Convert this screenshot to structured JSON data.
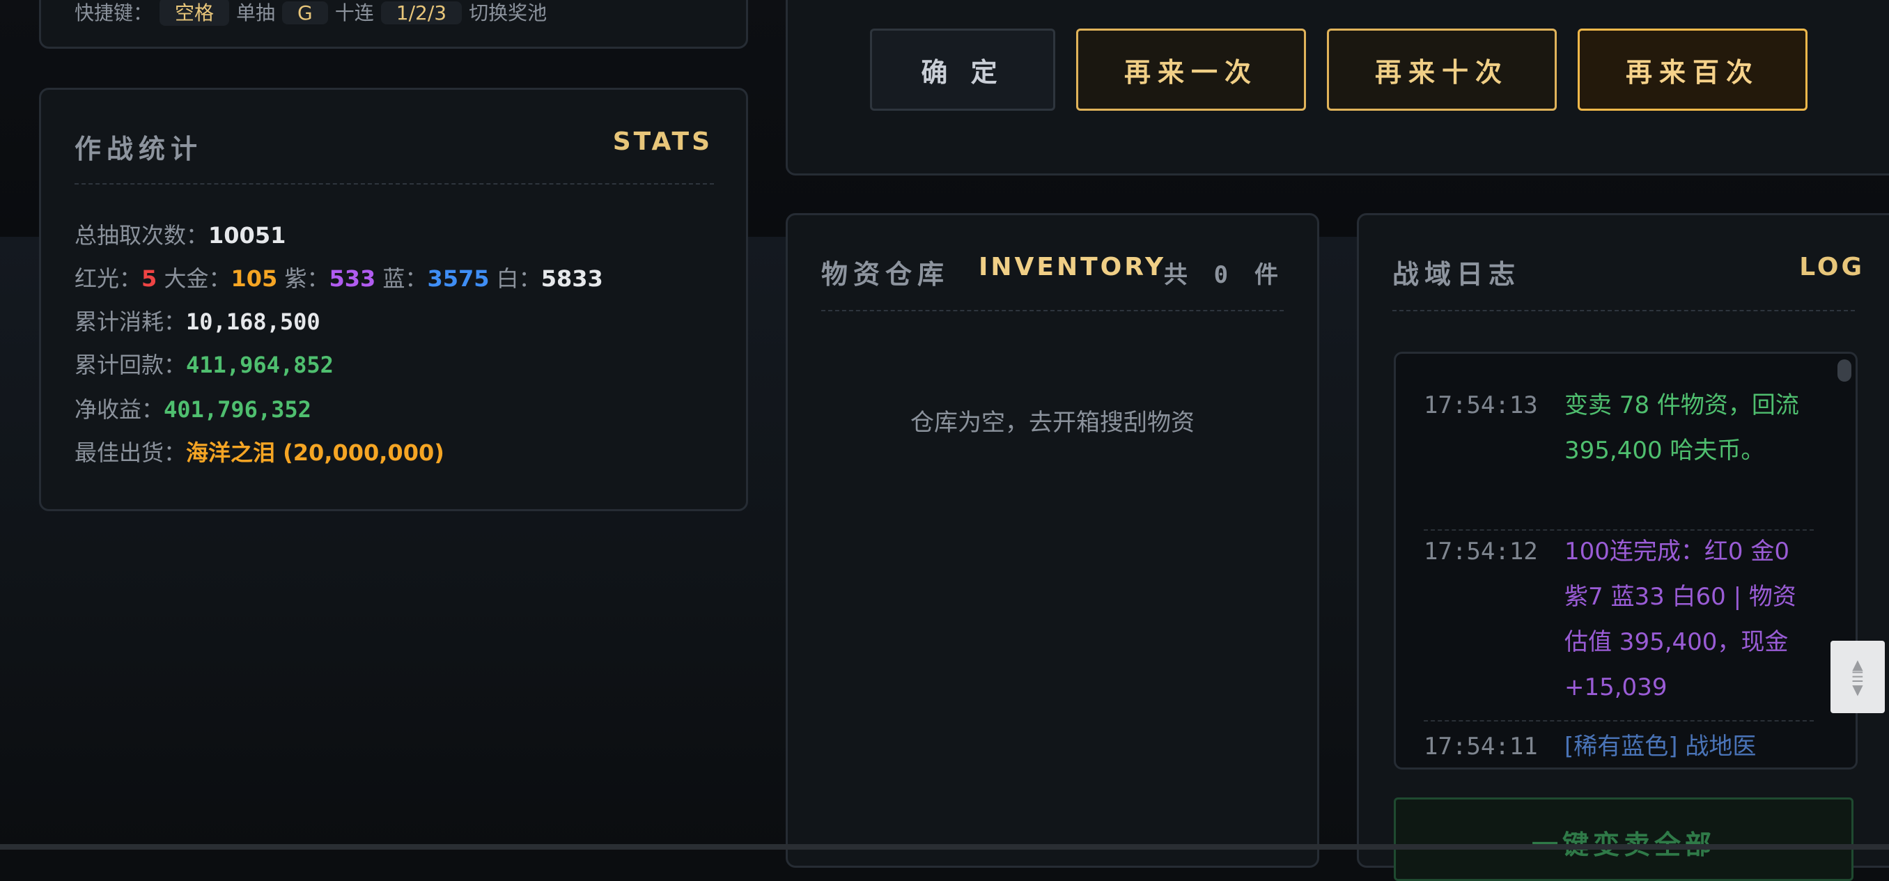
{
  "shortcuts": {
    "prefix": "快捷键：",
    "key1": "空格",
    "label1": "单抽",
    "key2": "G",
    "label2": "十连",
    "key3": "1/2/3",
    "label3": "切换奖池"
  },
  "actions": {
    "confirm": "确 定",
    "again_one": "再来一次",
    "again_ten": "再来十次",
    "again_hundred": "再来百次"
  },
  "stats": {
    "title": "作战统计",
    "tag": "STATS",
    "total_label": "总抽取次数：",
    "total_value": "10051",
    "red_label": "红光：",
    "red_value": "5",
    "gold_label": "大金：",
    "gold_value": "105",
    "purple_label": "紫：",
    "purple_value": "533",
    "blue_label": "蓝：",
    "blue_value": "3575",
    "white_label": "白：",
    "white_value": "5833",
    "cost_label": "累计消耗：",
    "cost_value": "10,168,500",
    "return_label": "累计回款：",
    "return_value": "411,964,852",
    "net_label": "净收益：",
    "net_value": "401,796,352",
    "best_label": "最佳出货：",
    "best_value": "海洋之泪 (20,000,000)"
  },
  "inventory": {
    "title": "物资仓库",
    "tag": "INVENTORY",
    "count_prefix": "共",
    "count": "0",
    "count_suffix": "件",
    "empty_text": "仓库为空，去开箱搜刮物资"
  },
  "log": {
    "title": "战域日志",
    "tag": "LOG",
    "entries": [
      {
        "time": "17:54:13",
        "text": "变卖 78 件物资，回流 395,400 哈夫币。"
      },
      {
        "time": "17:54:12",
        "text": "100连完成：红0 金0 紫7 蓝33 白60 | 物资估值 395,400，现金 +15,039"
      },
      {
        "time": "17:54:11",
        "text": "[稀有蓝色] 战地医"
      }
    ],
    "sell_all": "一键变卖全部"
  },
  "colors": {
    "gold": "#e8c67a",
    "red": "#ef4444",
    "orange": "#f5a524",
    "purple": "#b15cf0",
    "blue": "#3f8ef5",
    "white": "#e6e8eb",
    "green": "#4fbf6f",
    "log_purple": "#9a5cd6",
    "log_blue": "#4a74b8"
  }
}
